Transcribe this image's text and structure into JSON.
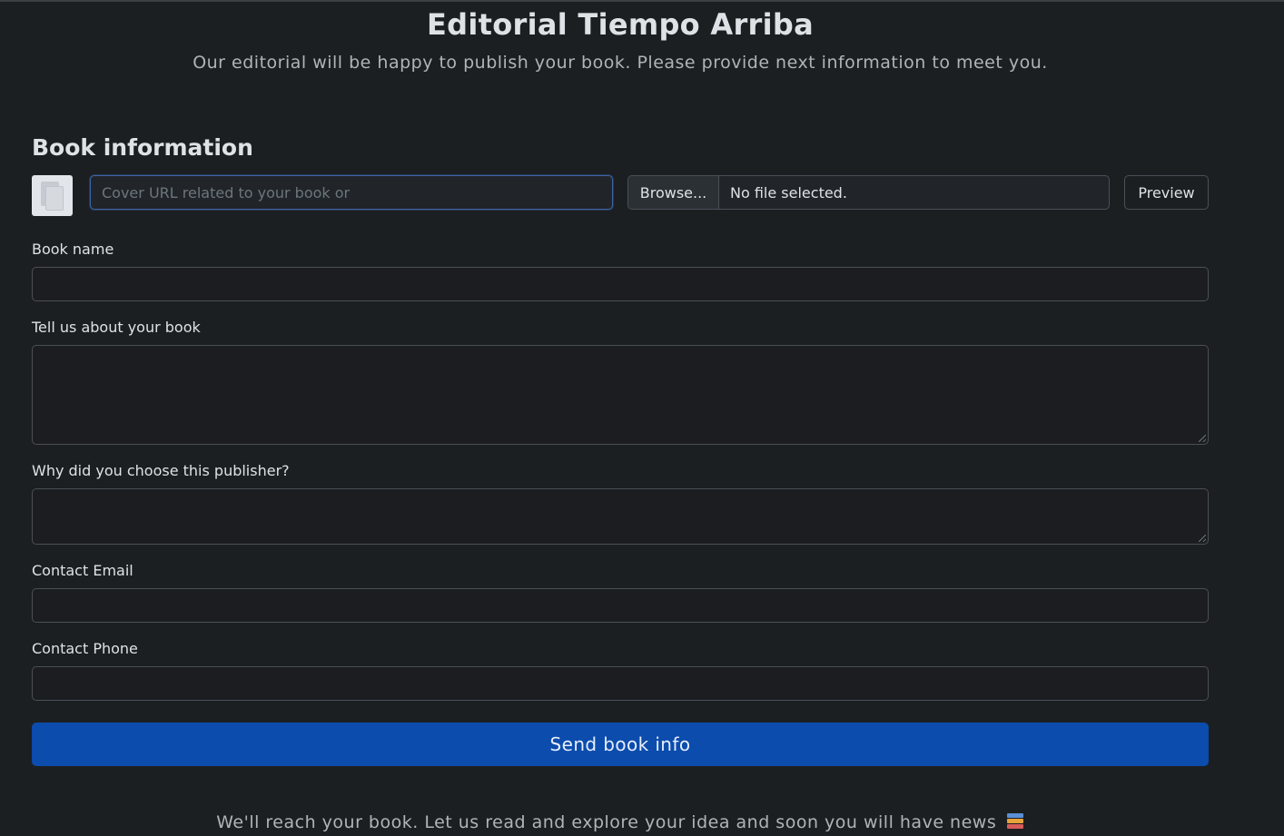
{
  "header": {
    "title": "Editorial Tiempo Arriba",
    "subtitle": "Our editorial will be happy to publish your book. Please provide next information to meet you."
  },
  "form": {
    "section_title": "Book information",
    "cover": {
      "url_placeholder": "Cover URL related to your book or",
      "browse_label": "Browse...",
      "file_status": "No file selected.",
      "preview_label": "Preview",
      "thumb_icon": "image-placeholder-icon"
    },
    "fields": {
      "book_name_label": "Book name",
      "about_label": "Tell us about your book",
      "why_label": "Why did you choose this publisher?",
      "email_label": "Contact Email",
      "phone_label": "Contact Phone"
    },
    "submit_label": "Send book info"
  },
  "footer": {
    "text": "We'll reach your book. Let us read and explore your idea and soon you will have news",
    "icon": "books-icon"
  },
  "colors": {
    "background": "#1c1f21",
    "primary": "#0b4cad",
    "focus_border": "#3e63a8"
  }
}
